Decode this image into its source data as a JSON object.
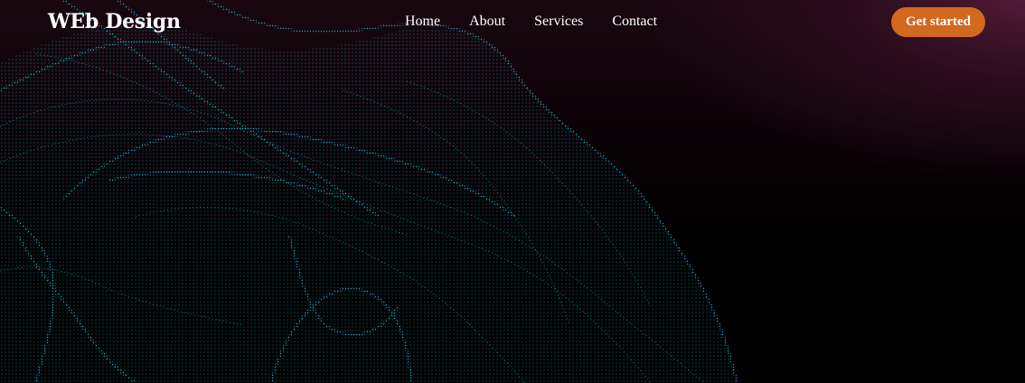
{
  "header": {
    "logo": "WEb Design",
    "nav": [
      "Home",
      "About",
      "Services",
      "Contact"
    ],
    "cta_label": "Get started"
  },
  "colors": {
    "cta_background": "#d2691e",
    "wave_dots": "#1fa9c9",
    "background_glow": "#4f1a35",
    "background": "#000000"
  },
  "icons": {
    "hero_graphic": "particle-wave-graphic"
  }
}
